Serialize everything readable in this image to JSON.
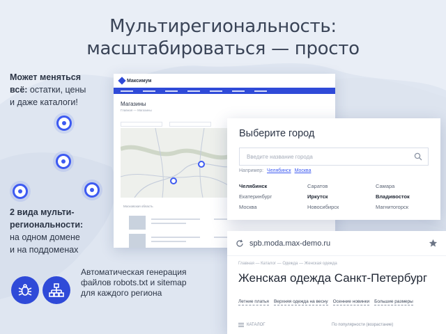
{
  "headline": {
    "line1": "Мультирегиональность:",
    "line2": "масштабироваться — просто"
  },
  "left_top": {
    "line1": "Может меняться",
    "line2_bold": "всё:",
    "line2_rest": " остатки, цены",
    "line3": "и даже каталоги!"
  },
  "left_mid": {
    "line1": "2 вида мульти-",
    "line2": "региональности:",
    "line3": "на одном домене",
    "line4": "и на поддоменах"
  },
  "feature": {
    "line1": "Автоматическая генерация",
    "line2": "файлов robots.txt и sitemap",
    "line3": "для каждого региона",
    "icons": [
      "bug-icon",
      "sitemap-icon"
    ]
  },
  "site": {
    "brand": "Максимум",
    "page_title": "Магазины",
    "breadcrumb": "Главная — Магазины",
    "list_title": "Московская область"
  },
  "city_selector": {
    "title": "Выберите город",
    "search_placeholder": "Введите название города",
    "example_label": "Например:",
    "example_links": [
      "Челябинск",
      "Москва"
    ],
    "cities": [
      [
        "Челябинск",
        "Саратов",
        "Самара"
      ],
      [
        "Екатеринбург",
        "Иркутск",
        "Владивосток"
      ],
      [
        "Москва",
        "Новосибирск",
        "Магнитогорск"
      ]
    ],
    "bold_cities": [
      "Челябинск",
      "Иркутск",
      "Владивосток"
    ]
  },
  "browser": {
    "url": "spb.moda.max-demo.ru",
    "breadcrumbs": "Главная — Каталог — Одежда — Женская одежда",
    "h1": "Женская одежда Санкт-Петербург",
    "chips": [
      "Летние платья",
      "Верхняя одежда на весну",
      "Осенние новинки",
      "Большие размеры"
    ],
    "catalog_label": "КАТАЛОГ",
    "sort_label": "По популярности (возрастание)"
  },
  "colors": {
    "accent": "#2f4ad8",
    "pin": "#3d5af1",
    "background": "#e9eef6"
  }
}
